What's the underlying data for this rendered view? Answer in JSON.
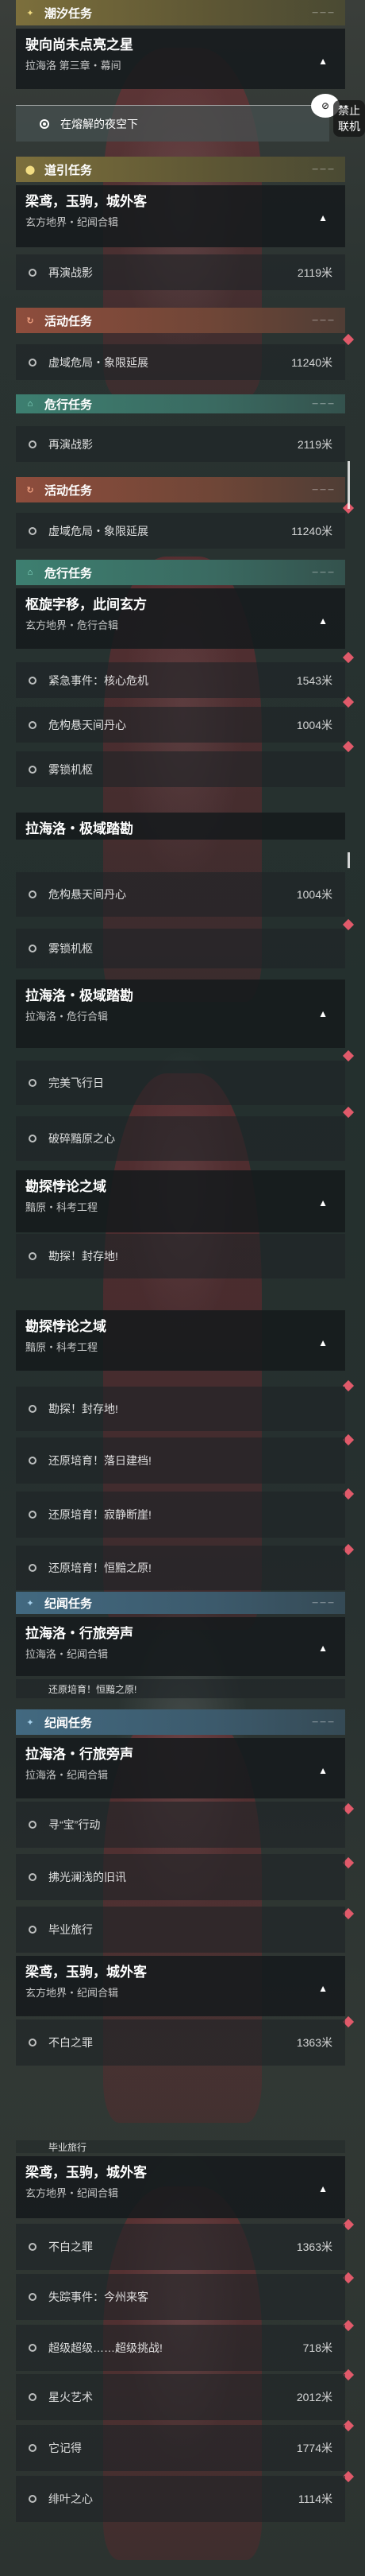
{
  "groups": {
    "chaoxi": "潮汐任务",
    "daoyin": "道引任务",
    "huodong": "活动任务",
    "weixing": "危行任务",
    "jiwen": "纪闻任务"
  },
  "header_tag": "— — —",
  "q1": {
    "title": "驶向尚未点亮之星",
    "sub": "拉海洛 第三章・幕间",
    "selected": "在熔解的夜空下"
  },
  "badge": {
    "label": "禁止联机"
  },
  "q_liang": {
    "title": "梁鸢，玉驹，城外客",
    "sub": "玄方地界・纪闻合辑"
  },
  "row_zaiyan": {
    "label": "再演战影",
    "dist": "2119米"
  },
  "row_xuyu": {
    "label": "虚域危局・象限延展",
    "dist": "11240米"
  },
  "q_shuxuan": {
    "title": "枢旋字移，此间玄方",
    "sub": "玄方地界・危行合辑"
  },
  "row_jinji": {
    "label": "紧急事件：核心危机",
    "dist": "1543米"
  },
  "row_weiji": {
    "label": "危构悬天间丹心",
    "dist": "1004米"
  },
  "row_wosuo": {
    "label": "雾锁机枢"
  },
  "q_jiyu": {
    "title": "拉海洛・极域踏勘",
    "sub": "拉海洛・危行合辑"
  },
  "row_wanmei": {
    "label": "完美飞行日"
  },
  "row_posui": {
    "label": "破碎黯原之心"
  },
  "q_kance": {
    "title": "勘探悖论之域",
    "sub": "黯原・科考工程"
  },
  "row_kance1": {
    "label": "勘探！封存地!"
  },
  "row_huanyuan1": {
    "label": "还原培育！落日建档!"
  },
  "row_huanyuan2": {
    "label": "还原培育！寂静断崖!"
  },
  "row_huanyuan3": {
    "label": "还原培育！恒黯之原!"
  },
  "q_lvxing": {
    "title": "拉海洛・行旅旁声",
    "sub": "拉海洛・纪闻合辑"
  },
  "row_xunbao": {
    "label": "寻“宝”行动"
  },
  "row_fuguang": {
    "label": "拂光澜浅的旧讯"
  },
  "row_biye": {
    "label": "毕业旅行"
  },
  "row_bubai": {
    "label": "不白之罪",
    "dist": "1363米"
  },
  "row_shizong": {
    "label": "失踪事件：今州来客"
  },
  "row_chaoji": {
    "label": "超级超级……超级挑战!",
    "dist": "718米"
  },
  "row_xinghuo": {
    "label": "星火艺术",
    "dist": "2012米"
  },
  "row_taji": {
    "label": "它记得",
    "dist": "1774米"
  },
  "row_feizhi": {
    "label": "绯叶之心",
    "dist": "1114米"
  },
  "colors": {
    "yellow": "#7c6f3c",
    "orange": "#8e4d3c",
    "teal": "#3d7f70",
    "blue": "#426980",
    "marker": "#e05a6a"
  }
}
